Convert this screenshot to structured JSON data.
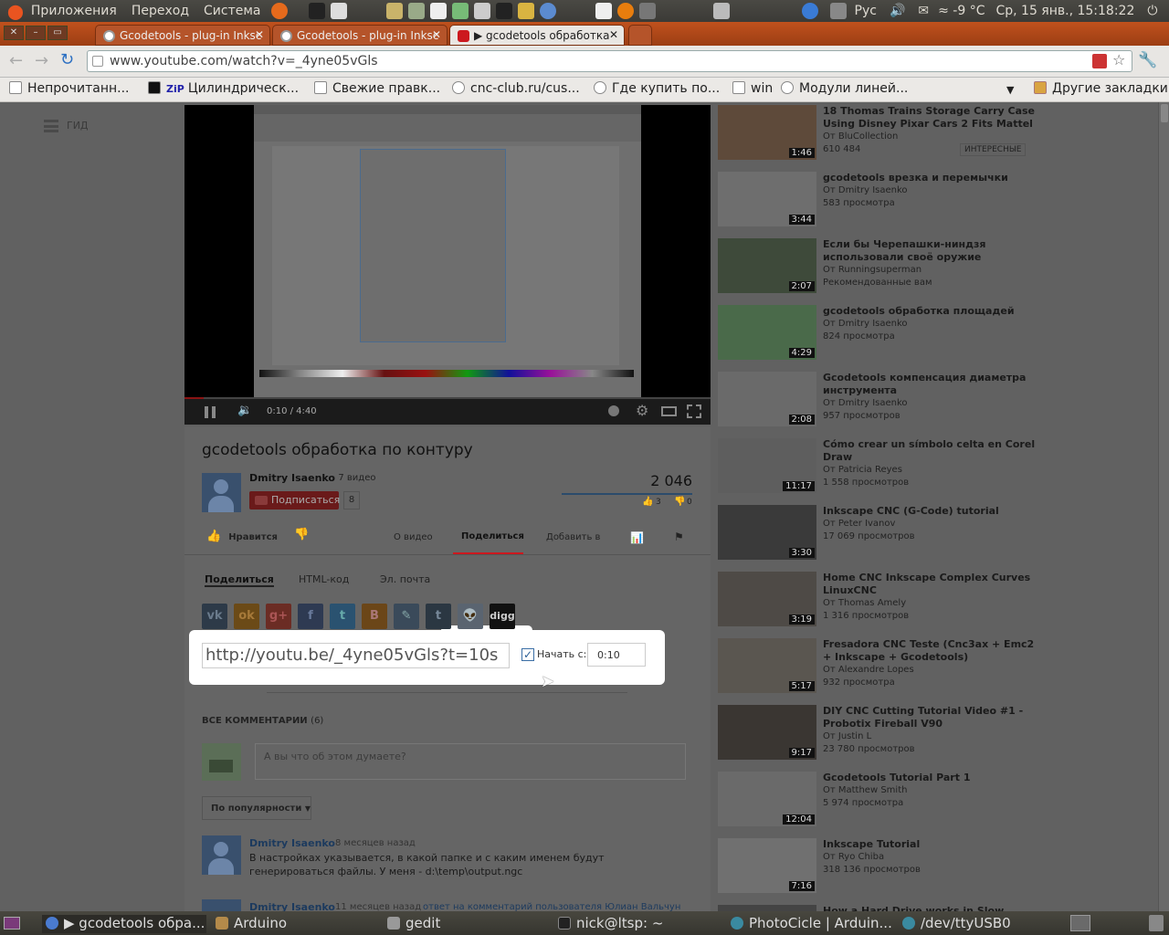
{
  "topbar": {
    "menu": [
      "Приложения",
      "Переход",
      "Система"
    ],
    "layout": "Рус",
    "weather": "≈ -9 °C",
    "datetime": "Ср, 15 янв., 15:18:22"
  },
  "tabs": [
    {
      "label": "Gcodetools - plug-in Inksc",
      "active": false
    },
    {
      "label": "Gcodetools - plug-in Inksc",
      "active": false
    },
    {
      "label": "▶ gcodetools обработка",
      "active": true
    }
  ],
  "omnibox": {
    "url": "www.youtube.com/watch?v=_4yne05vGls"
  },
  "bookmarks": [
    "Непрочитанн...",
    "Цилиндрическ...",
    "Свежие правк...",
    "cnc-club.ru/cus...",
    "Где купить по...",
    "win",
    "Модули линей...",
    "Другие закладки"
  ],
  "guide_label": "ГИД",
  "player": {
    "time": "0:10 / 4:40",
    "progress": 0.036
  },
  "video": {
    "title": "gcodetools обработка по контуру",
    "channel": "Dmitry Isaenko",
    "video_count": "· 7 видео",
    "subscribe": "Подписаться",
    "subscribers": "8",
    "views": "2 046",
    "likes": "3",
    "dislikes": "0",
    "like_label": "Нравится",
    "about": "О видео",
    "share": "Поделиться",
    "add_to": "Добавить в"
  },
  "share_tabs": [
    "Поделиться",
    "HTML-код",
    "Эл. почта"
  ],
  "share": {
    "url": "http://youtu.be/_4yne05vGls?t=10s",
    "start_label": "Начать с:",
    "start_value": "0:10",
    "start_checked": true
  },
  "comments": {
    "header": "ВСЕ КОММЕНТАРИИ",
    "count": "(6)",
    "placeholder": "А вы что об этом думаете?",
    "sort": "По популярности",
    "items": [
      {
        "author": "Dmitry Isaenko",
        "time": "8 месяцев назад",
        "reply": "",
        "text": "В настройках указывается, в какой папке и с каким именем будут генерироваться файлы. У меня - d:\\temp\\output.ngc"
      },
      {
        "author": "Dmitry Isaenko",
        "time": "11 месяцев назад",
        "reply": "ответ на комментарий пользователя Юлиан Вальчун",
        "text": ""
      }
    ]
  },
  "related": [
    {
      "title": "18 Thomas Trains Storage Carry Case Using Disney Pixar Cars 2 Fits Mattel",
      "author": "От BluCollection",
      "views": "610 484",
      "dur": "1:46",
      "badge": "ИНТЕРЕСНЫЕ"
    },
    {
      "title": "gcodetools врезка и перемычки",
      "author": "От Dmitry Isaenko",
      "views": "583 просмотра",
      "dur": "3:44",
      "badge": ""
    },
    {
      "title": "Если бы Черепашки-ниндзя использовали своё оружие",
      "author": "От Runningsuperman",
      "views": "Рекомендованные вам",
      "dur": "2:07",
      "badge": ""
    },
    {
      "title": "gcodetools обработка площадей",
      "author": "От Dmitry Isaenko",
      "views": "824 просмотра",
      "dur": "4:29",
      "badge": ""
    },
    {
      "title": "Gcodetools компенсация диаметра инструмента",
      "author": "От Dmitry Isaenko",
      "views": "957 просмотров",
      "dur": "2:08",
      "badge": ""
    },
    {
      "title": "Cómo crear un símbolo celta en Corel Draw",
      "author": "От Patricia Reyes",
      "views": "1 558 просмотров",
      "dur": "11:17",
      "badge": ""
    },
    {
      "title": "Inkscape CNC (G-Code) tutorial",
      "author": "От Peter Ivanov",
      "views": "17 069 просмотров",
      "dur": "3:30",
      "badge": ""
    },
    {
      "title": "Home CNC Inkscape Complex Curves LinuxCNC",
      "author": "От Thomas Amely",
      "views": "1 316 просмотров",
      "dur": "3:19",
      "badge": ""
    },
    {
      "title": "Fresadora CNC Teste (Cnc3ax + Emc2 + Inkscape + Gcodetools)",
      "author": "От Alexandre Lopes",
      "views": "932 просмотра",
      "dur": "5:17",
      "badge": ""
    },
    {
      "title": "DIY CNC Cutting Tutorial Video #1 - Probotix Fireball V90",
      "author": "От Justin L",
      "views": "23 780 просмотров",
      "dur": "9:17",
      "badge": ""
    },
    {
      "title": "Gcodetools Tutorial Part 1",
      "author": "От Matthew Smith",
      "views": "5 974 просмотра",
      "dur": "12:04",
      "badge": ""
    },
    {
      "title": "Inkscape Tutorial",
      "author": "От Ryo Chiba",
      "views": "318 136 просмотров",
      "dur": "7:16",
      "badge": ""
    },
    {
      "title": "How a Hard Drive works in Slow Motion -",
      "author": "",
      "views": "",
      "dur": "",
      "badge": ""
    }
  ],
  "taskbar": [
    "▶ gcodetools обра...",
    "Arduino",
    "gedit",
    "nick@ltsp: ~",
    "PhotoCicle | Arduin...",
    "/dev/ttyUSB0"
  ],
  "colors": {
    "youtube_red": "#cc181e",
    "overlay": "#616161",
    "tabs_orange": "#b5542a"
  }
}
